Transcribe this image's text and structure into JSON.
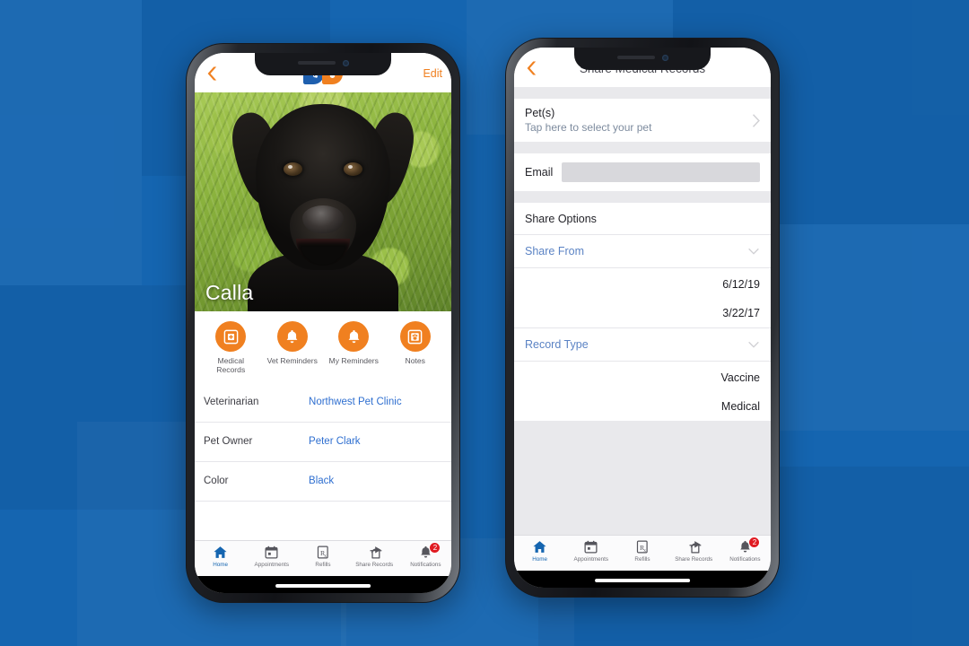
{
  "theme": {
    "background_blue": "#1565b0",
    "accent_orange": "#f08020",
    "link_blue": "#2f6fd0",
    "active_tab_blue": "#1565b0",
    "badge_red": "#e01b22"
  },
  "phone_left": {
    "navbar": {
      "back_icon": "chevron-left-icon",
      "logo_bubble_blue_icon": "stethoscope-speech-bubble-icon",
      "logo_bubble_orange_icon": "paw-speech-bubble-icon",
      "edit_label": "Edit"
    },
    "hero": {
      "pet_name": "Calla",
      "photo_alt": "black-labrador-on-grass"
    },
    "actions": [
      {
        "icon": "medical-record-icon",
        "label": "Medical Records"
      },
      {
        "icon": "bell-icon",
        "label": "Vet Reminders"
      },
      {
        "icon": "bell-icon",
        "label": "My Reminders"
      },
      {
        "icon": "notes-paw-icon",
        "label": "Notes"
      }
    ],
    "info_rows": [
      {
        "key": "Veterinarian",
        "value": "Northwest Pet Clinic"
      },
      {
        "key": "Pet Owner",
        "value": "Peter Clark"
      },
      {
        "key": "Color",
        "value": "Black"
      }
    ]
  },
  "phone_right": {
    "navbar": {
      "back_icon": "chevron-left-icon",
      "title": "Share Medical Records"
    },
    "pet_section": {
      "title": "Pet(s)",
      "subtitle": "Tap here to select your pet",
      "chevron_icon": "chevron-right-icon"
    },
    "email_section": {
      "label": "Email",
      "value": "",
      "placeholder": ""
    },
    "share_options": {
      "section_title": "Share Options",
      "share_from": {
        "label": "Share From",
        "chevron_icon": "chevron-down-icon",
        "values": [
          "6/12/19",
          "3/22/17"
        ]
      },
      "record_type": {
        "label": "Record Type",
        "chevron_icon": "chevron-down-icon",
        "values": [
          "Vaccine",
          "Medical"
        ]
      }
    }
  },
  "tabbar": {
    "tabs": [
      {
        "icon": "home-icon",
        "label": "Home",
        "active": true,
        "badge": ""
      },
      {
        "icon": "calendar-icon",
        "label": "Appointments",
        "active": false,
        "badge": ""
      },
      {
        "icon": "rx-icon",
        "label": "Refills",
        "active": false,
        "badge": ""
      },
      {
        "icon": "share-icon",
        "label": "Share Records",
        "active": false,
        "badge": ""
      },
      {
        "icon": "bell-icon",
        "label": "Notifications",
        "active": false,
        "badge": "2"
      }
    ]
  }
}
